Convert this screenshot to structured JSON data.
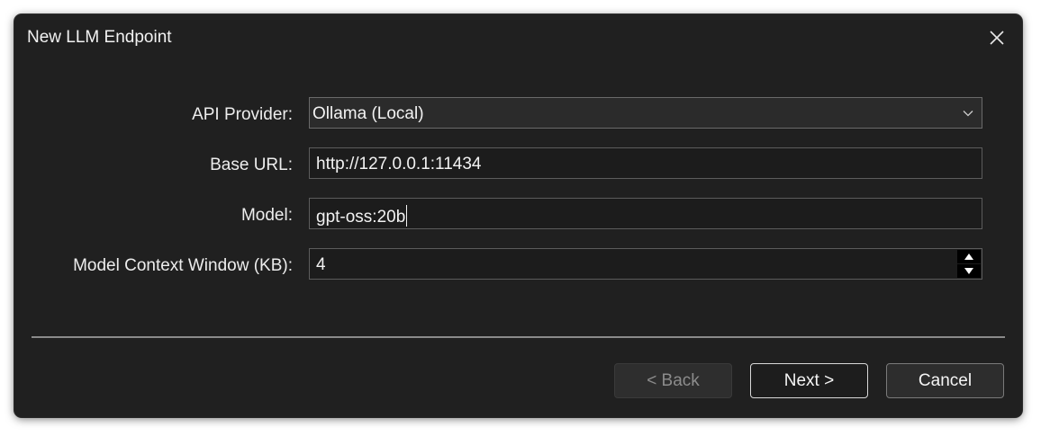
{
  "window": {
    "title": "New LLM Endpoint",
    "close_icon": "close-icon"
  },
  "form": {
    "api_provider": {
      "label": "API Provider:",
      "selected": "Ollama (Local)",
      "icon": "chevron-down-icon"
    },
    "base_url": {
      "label": "Base URL:",
      "value": "http://127.0.0.1:11434"
    },
    "model": {
      "label": "Model:",
      "value": "gpt-oss:20b"
    },
    "context_window": {
      "label": "Model Context Window (KB):",
      "value": "4",
      "up_icon": "arrow-up-icon",
      "down_icon": "arrow-down-icon"
    }
  },
  "buttons": {
    "back": "< Back",
    "next": "Next >",
    "cancel": "Cancel"
  },
  "colors": {
    "dialog_background": "#202020",
    "text": "#f0f0f0",
    "disabled_text": "#8c8c8c",
    "default_button_border": "#d8d8d8"
  }
}
